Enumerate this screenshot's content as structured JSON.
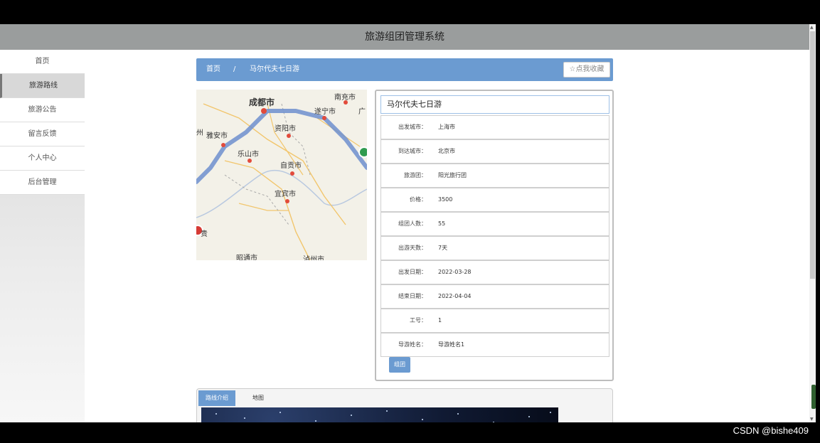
{
  "app": {
    "title": "旅游组团管理系统"
  },
  "sidebar": {
    "items": [
      {
        "label": "首页"
      },
      {
        "label": "旅游路线",
        "active": true
      },
      {
        "label": "旅游公告"
      },
      {
        "label": "留言反馈"
      },
      {
        "label": "个人中心"
      },
      {
        "label": "后台管理"
      }
    ]
  },
  "breadcrumb": {
    "home": "首页",
    "current": "马尔代夫七日游"
  },
  "favorite": {
    "label": "☆点我收藏"
  },
  "map": {
    "labels": [
      "成都市",
      "南充市",
      "遂宁市",
      "资阳市",
      "雅安市",
      "乐山市",
      "自贡市",
      "宜宾市",
      "昭通市",
      "泸州市",
      "州",
      "贵",
      "广"
    ]
  },
  "info": {
    "title": "马尔代夫七日游",
    "rows": [
      {
        "label": "出发城市：",
        "value": "上海市"
      },
      {
        "label": "到达城市：",
        "value": "北京市"
      },
      {
        "label": "旅游团：",
        "value": "阳光旅行团"
      },
      {
        "label": "价格：",
        "value": "3500"
      },
      {
        "label": "组团人数：",
        "value": "55"
      },
      {
        "label": "出游天数：",
        "value": "7天"
      },
      {
        "label": "出发日期：",
        "value": "2022-03-28"
      },
      {
        "label": "结束日期：",
        "value": "2022-04-04"
      },
      {
        "label": "工号：",
        "value": "1"
      },
      {
        "label": "导游姓名：",
        "value": "导游姓名1"
      }
    ],
    "group_button": "组团"
  },
  "tabs": {
    "items": [
      {
        "label": "路线介绍",
        "active": true
      },
      {
        "label": "地图"
      }
    ]
  },
  "watermark": "CSDN @bishe409",
  "colors": {
    "header_bg": "#9a9d9d",
    "accent": "#6b9bd1"
  }
}
